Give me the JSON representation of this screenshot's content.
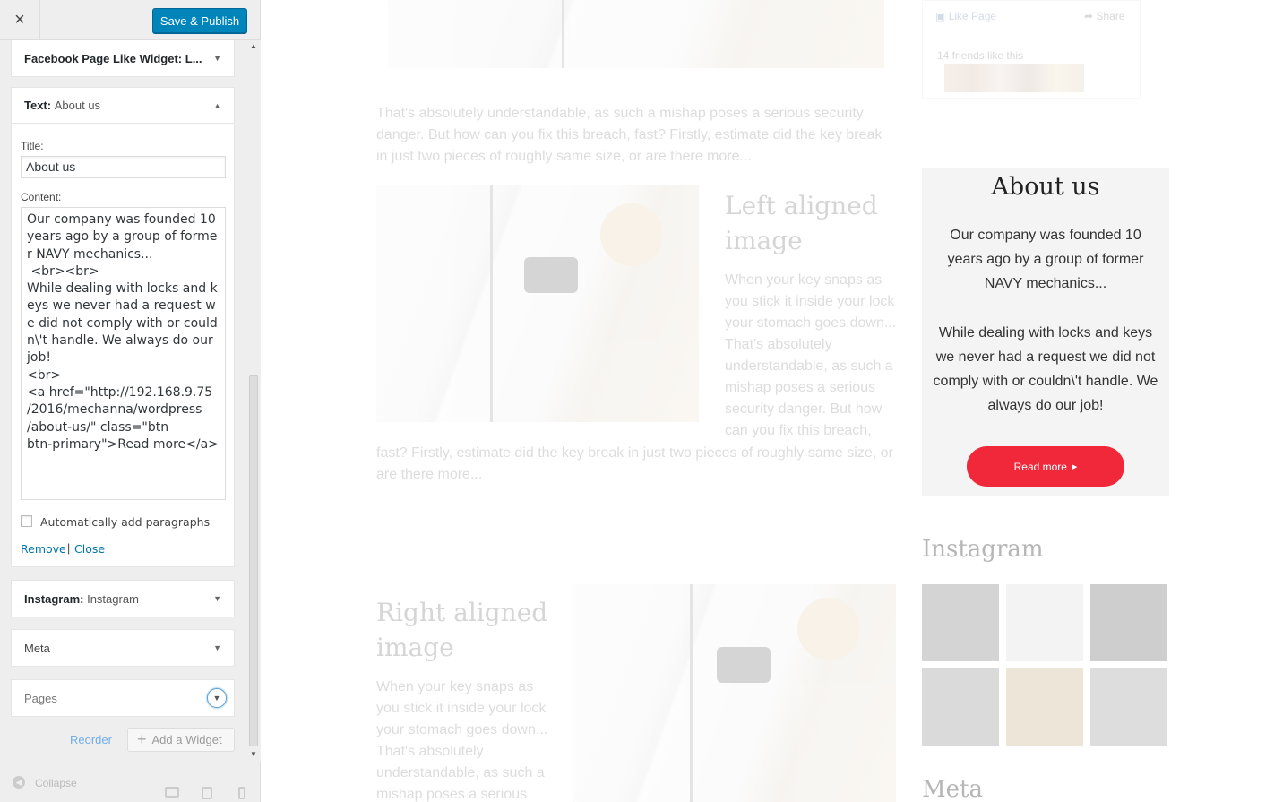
{
  "sidebar": {
    "close_icon": "×",
    "save_label": "Save & Publish",
    "widgets": [
      {
        "name": "Facebook Page Like Widget: L...",
        "title": ""
      },
      {
        "name": "Text:",
        "title": "About us"
      },
      {
        "name": "Instagram:",
        "title": "Instagram"
      },
      {
        "name": "Meta",
        "title": ""
      },
      {
        "name": "Pages",
        "title": ""
      }
    ],
    "text_widget": {
      "title_label": "Title:",
      "title_value": "About us",
      "content_label": "Content:",
      "content_value": "Our company was founded 10 years ago by a group of former NAVY mechanics...\n <br><br>\nWhile dealing with locks and keys we never had a request we did not comply with or couldn\\'t handle. We always do our job!\n<br>\n<a href=\"http://192.168.9.75\n/2016/mechanna/wordpress\n/about-us/\" class=\"btn\nbtn-primary\">Read more</a>",
      "autop_label": "Automatically add paragraphs",
      "autop_checked": false,
      "remove_label": "Remove",
      "separator": "|",
      "close_label": "Close"
    },
    "reorder_label": "Reorder",
    "add_widget_label": "Add a Widget",
    "collapse_label": "Collapse"
  },
  "preview": {
    "facebook": {
      "like_label": "Like Page",
      "share_label": "Share",
      "friends_text": "14 friends like this"
    },
    "intro_paragraph": "That's absolutely understandable, as such a mishap poses a serious security danger. But how can you fix this breach, fast? Firstly, estimate did the key break in just two pieces of roughly same size, or are there more...",
    "left_heading": "Left aligned image",
    "left_paragraph": "When your key snaps as you stick it inside your lock your stomach goes down... That's absolutely understandable, as such a mishap poses a serious security danger. But how can you fix this breach,",
    "left_paragraph_cont": "fast? Firstly, estimate did the key break in just two pieces of roughly same size, or are there more...",
    "right_heading": "Right aligned image",
    "right_paragraph": "When your key snaps as you stick it inside your lock your stomach goes down... That's absolutely understandable, as such a mishap poses a serious",
    "about": {
      "title": "About us",
      "text_1": "Our company was founded 10 years ago by a group of former NAVY mechanics...",
      "text_2": "While dealing with locks and keys we never had a request we did not comply with or couldn\\'t handle. We always do our job!",
      "button": "Read more",
      "accent": "#f0283a"
    },
    "instagram_title": "Instagram",
    "meta_title": "Meta"
  }
}
